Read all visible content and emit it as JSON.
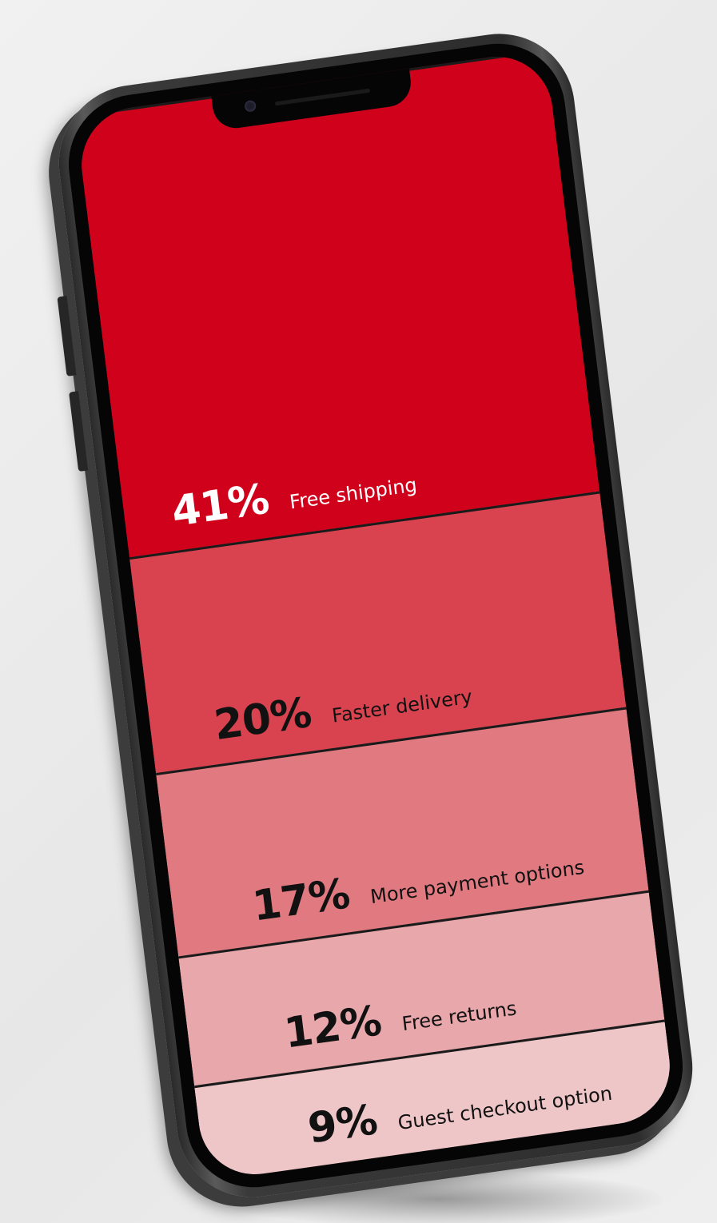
{
  "chart_data": {
    "type": "bar",
    "categories": [
      "Free shipping",
      "Faster delivery",
      "More payment options",
      "Free returns",
      "Guest checkout option"
    ],
    "values": [
      41,
      20,
      17,
      12,
      9
    ],
    "unit": "%",
    "value_labels": [
      "41%",
      "20%",
      "17%",
      "12%",
      "9%"
    ],
    "colors": [
      "#d0021b",
      "#d9434f",
      "#e07a80",
      "#e8a7ab",
      "#efc6c8"
    ],
    "text_colors": [
      "#ffffff",
      "#111111",
      "#111111",
      "#111111",
      "#111111"
    ]
  }
}
